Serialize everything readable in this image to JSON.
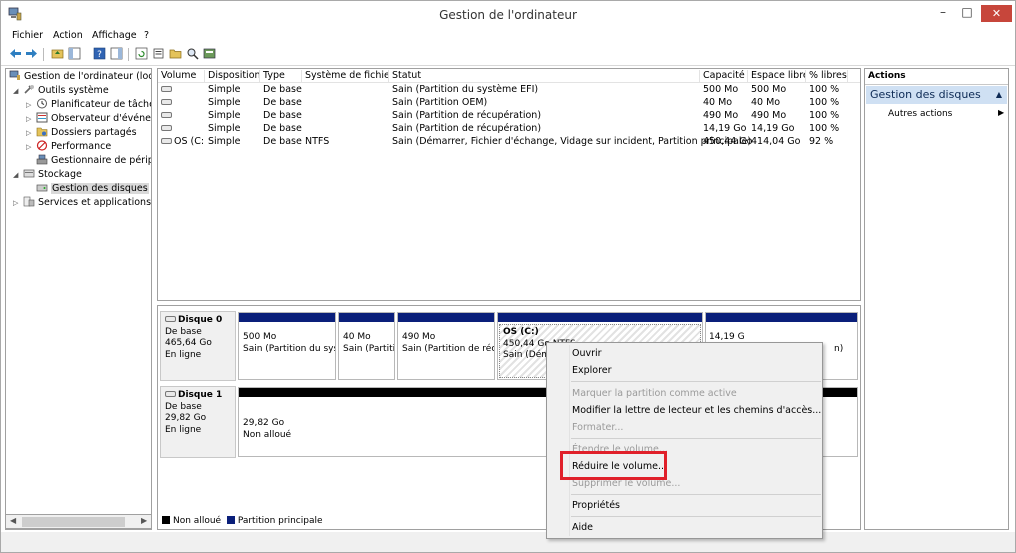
{
  "window": {
    "title": "Gestion de l'ordinateur",
    "min_glyph": "–",
    "max_glyph": "□",
    "close_glyph": "✕"
  },
  "menu": [
    "Fichier",
    "Action",
    "Affichage",
    "?"
  ],
  "tree": {
    "root": "Gestion de l'ordinateur (local)",
    "outils": "Outils système",
    "planificateur": "Planificateur de tâches",
    "observateur": "Observateur d'événements",
    "dossiers": "Dossiers partagés",
    "performance": "Performance",
    "gestionnaire": "Gestionnaire de périphériques",
    "stockage": "Stockage",
    "gestion_disques": "Gestion des disques",
    "services": "Services et applications"
  },
  "volumes": {
    "headers": [
      "Volume",
      "Disposition",
      "Type",
      "Système de fichiers",
      "Statut",
      "Capacité",
      "Espace libre",
      "% libres"
    ],
    "rows": [
      {
        "volume": "",
        "disposition": "Simple",
        "type": "De base",
        "fs": "",
        "statut": "Sain (Partition du système EFI)",
        "capacite": "500 Mo",
        "libre": "500 Mo",
        "pct": "100 %"
      },
      {
        "volume": "",
        "disposition": "Simple",
        "type": "De base",
        "fs": "",
        "statut": "Sain (Partition OEM)",
        "capacite": "40 Mo",
        "libre": "40 Mo",
        "pct": "100 %"
      },
      {
        "volume": "",
        "disposition": "Simple",
        "type": "De base",
        "fs": "",
        "statut": "Sain (Partition de récupération)",
        "capacite": "490 Mo",
        "libre": "490 Mo",
        "pct": "100 %"
      },
      {
        "volume": "",
        "disposition": "Simple",
        "type": "De base",
        "fs": "",
        "statut": "Sain (Partition de récupération)",
        "capacite": "14,19 Go",
        "libre": "14,19 Go",
        "pct": "100 %"
      },
      {
        "volume": "OS (C:)",
        "disposition": "Simple",
        "type": "De base",
        "fs": "NTFS",
        "statut": "Sain (Démarrer, Fichier d'échange, Vidage sur incident, Partition principale)",
        "capacite": "450,44 Go",
        "libre": "414,04 Go",
        "pct": "92 %"
      }
    ]
  },
  "disks": {
    "disk0": {
      "name": "Disque 0",
      "type": "De base",
      "size": "465,64 Go",
      "state": "En ligne"
    },
    "disk1": {
      "name": "Disque 1",
      "type": "De base",
      "size": "29,82 Go",
      "state": "En ligne"
    },
    "partitions": {
      "p1_size": "500 Mo",
      "p1_status": "Sain (Partition du syst",
      "p2_size": "40 Mo",
      "p2_status": "Sain (Partiti",
      "p3_size": "490 Mo",
      "p3_status": "Sain (Partition de récu",
      "os_name": "OS  (C:)",
      "os_size": "450,44 Go NTFS",
      "os_status": "Sain (Démar",
      "p5_size": "14,19 G",
      "p5_status": "n)",
      "d1_size": "29,82 Go",
      "d1_status": "Non alloué"
    },
    "legend": {
      "unallocated": "Non alloué",
      "primary": "Partition principale"
    }
  },
  "actions": {
    "header": "Actions",
    "section": "Gestion des disques",
    "more": "Autres actions"
  },
  "context_menu": {
    "ouvrir": "Ouvrir",
    "explorer": "Explorer",
    "marquer": "Marquer la partition comme active",
    "modifier": "Modifier la lettre de lecteur et les chemins d'accès...",
    "formater": "Formater...",
    "etendre": "Étendre le volume...",
    "reduire": "Réduire le volume...",
    "supprimer": "Supprimer le volume...",
    "proprietes": "Propriétés",
    "aide": "Aide"
  },
  "colors": {
    "primary_partition": "#0a1f7a",
    "unallocated": "#000000",
    "highlight": "#e0202a",
    "close_button": "#c7463b"
  }
}
